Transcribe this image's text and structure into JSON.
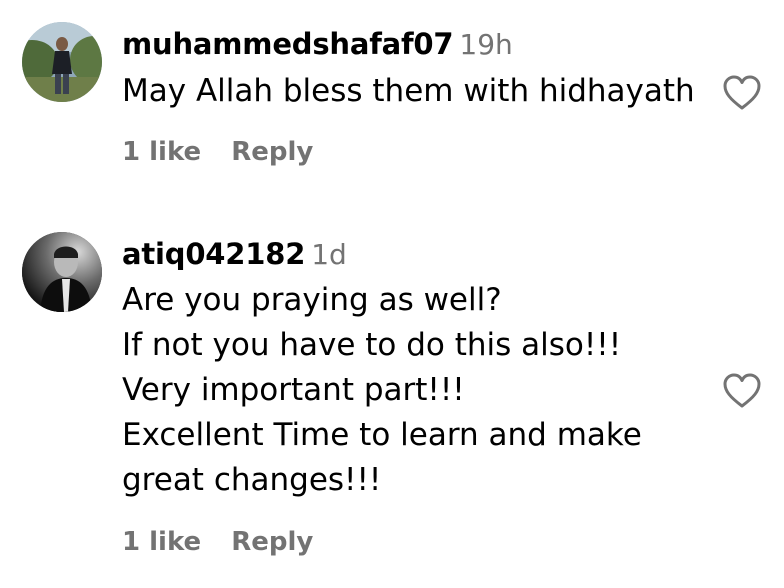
{
  "colors": {
    "primary_text": "#000000",
    "secondary_text": "#737373",
    "background": "#ffffff"
  },
  "comments": [
    {
      "username": "muhammedshafaf07",
      "time": "19h",
      "avatar_icon": "user-avatar-outdoor-photo",
      "lines": [
        "May Allah bless them with hidhayath"
      ],
      "likes_label": "1 like",
      "reply_label": "Reply",
      "like_icon": "heart-outline-icon"
    },
    {
      "username": "atiq042182",
      "time": "1d",
      "avatar_icon": "user-avatar-bw-photo",
      "lines": [
        "Are you praying as well?",
        "If not you have to do this also!!!",
        "Very important part!!!",
        "Excellent Time to learn and make",
        "great changes!!!"
      ],
      "likes_label": "1 like",
      "reply_label": "Reply",
      "like_icon": "heart-outline-icon"
    }
  ]
}
